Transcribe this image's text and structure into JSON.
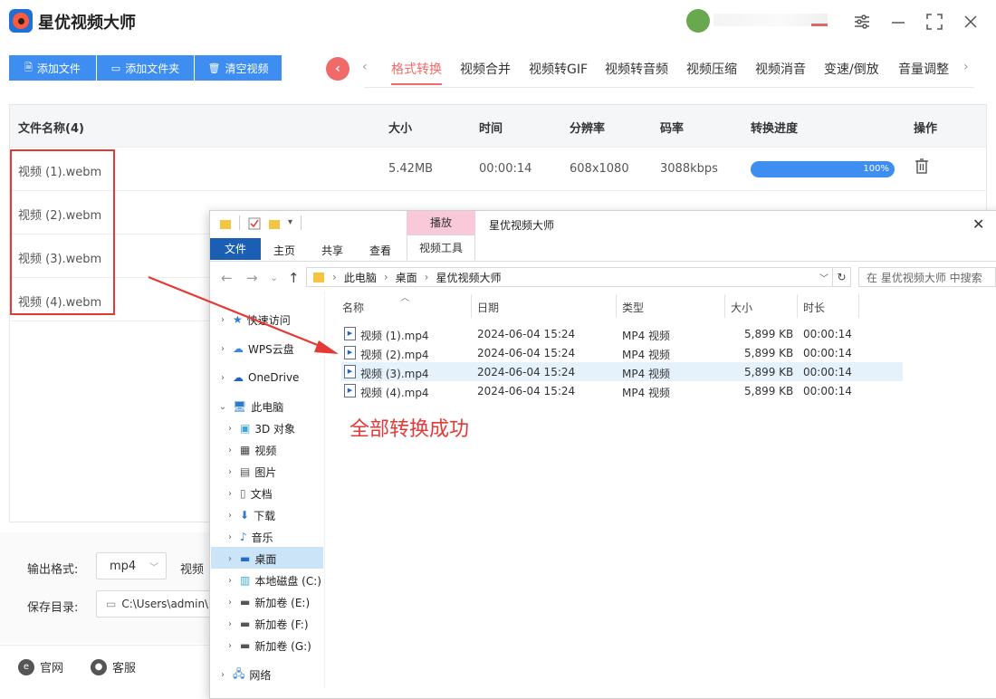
{
  "app": {
    "title": "星优视频大师"
  },
  "toolbar": {
    "add_file": "添加文件",
    "add_folder": "添加文件夹",
    "clear": "清空视频"
  },
  "tabs": [
    "格式转换",
    "视频合并",
    "视频转GIF",
    "视频转音频",
    "视频压缩",
    "视频消音",
    "变速/倒放",
    "音量调整"
  ],
  "table": {
    "headers": {
      "name": "文件名称(4)",
      "size": "大小",
      "time": "时间",
      "resolution": "分辨率",
      "bitrate": "码率",
      "progress": "转换进度",
      "action": "操作"
    },
    "rows": [
      {
        "name": "视频 (1).webm",
        "size": "5.42MB",
        "time": "00:00:14",
        "resolution": "608x1080",
        "bitrate": "3088kbps",
        "progress_label": "100%",
        "progress": 1.0
      },
      {
        "name": "视频 (2).webm"
      },
      {
        "name": "视频 (3).webm"
      },
      {
        "name": "视频 (4).webm"
      }
    ]
  },
  "settings": {
    "format_label": "输出格式:",
    "format_value": "mp4",
    "video_label_partial": "视频",
    "save_label": "保存目录:",
    "save_path": "C:\\Users\\admin\\"
  },
  "footer": {
    "website": "官网",
    "support": "客服"
  },
  "explorer": {
    "title": "星优视频大师",
    "ctx_tab": "播放",
    "ctx_tool": "视频工具",
    "ribbon": {
      "file": "文件",
      "home": "主页",
      "share": "共享",
      "view": "查看"
    },
    "breadcrumb": [
      "此电脑",
      "桌面",
      "星优视频大师"
    ],
    "search_placeholder": "在 星优视频大师 中搜索",
    "tree": [
      {
        "label": "快速访问"
      },
      {
        "label": "WPS云盘"
      },
      {
        "label": "OneDrive"
      },
      {
        "label": "此电脑"
      },
      {
        "label": "3D 对象"
      },
      {
        "label": "视频"
      },
      {
        "label": "图片"
      },
      {
        "label": "文档"
      },
      {
        "label": "下载"
      },
      {
        "label": "音乐"
      },
      {
        "label": "桌面"
      },
      {
        "label": "本地磁盘 (C:)"
      },
      {
        "label": "新加卷 (E:)"
      },
      {
        "label": "新加卷 (F:)"
      },
      {
        "label": "新加卷 (G:)"
      },
      {
        "label": "网络"
      }
    ],
    "columns": {
      "name": "名称",
      "date": "日期",
      "type": "类型",
      "size": "大小",
      "duration": "时长"
    },
    "files": [
      {
        "name": "视频 (1).mp4",
        "date": "2024-06-04 15:24",
        "type": "MP4 视频",
        "size": "5,899 KB",
        "duration": "00:00:14"
      },
      {
        "name": "视频 (2).mp4",
        "date": "2024-06-04 15:24",
        "type": "MP4 视频",
        "size": "5,899 KB",
        "duration": "00:00:14"
      },
      {
        "name": "视频 (3).mp4",
        "date": "2024-06-04 15:24",
        "type": "MP4 视频",
        "size": "5,899 KB",
        "duration": "00:00:14"
      },
      {
        "name": "视频 (4).mp4",
        "date": "2024-06-04 15:24",
        "type": "MP4 视频",
        "size": "5,899 KB",
        "duration": "00:00:14"
      }
    ]
  },
  "annotation": {
    "success_text": "全部转换成功",
    "color": "#e53935"
  }
}
